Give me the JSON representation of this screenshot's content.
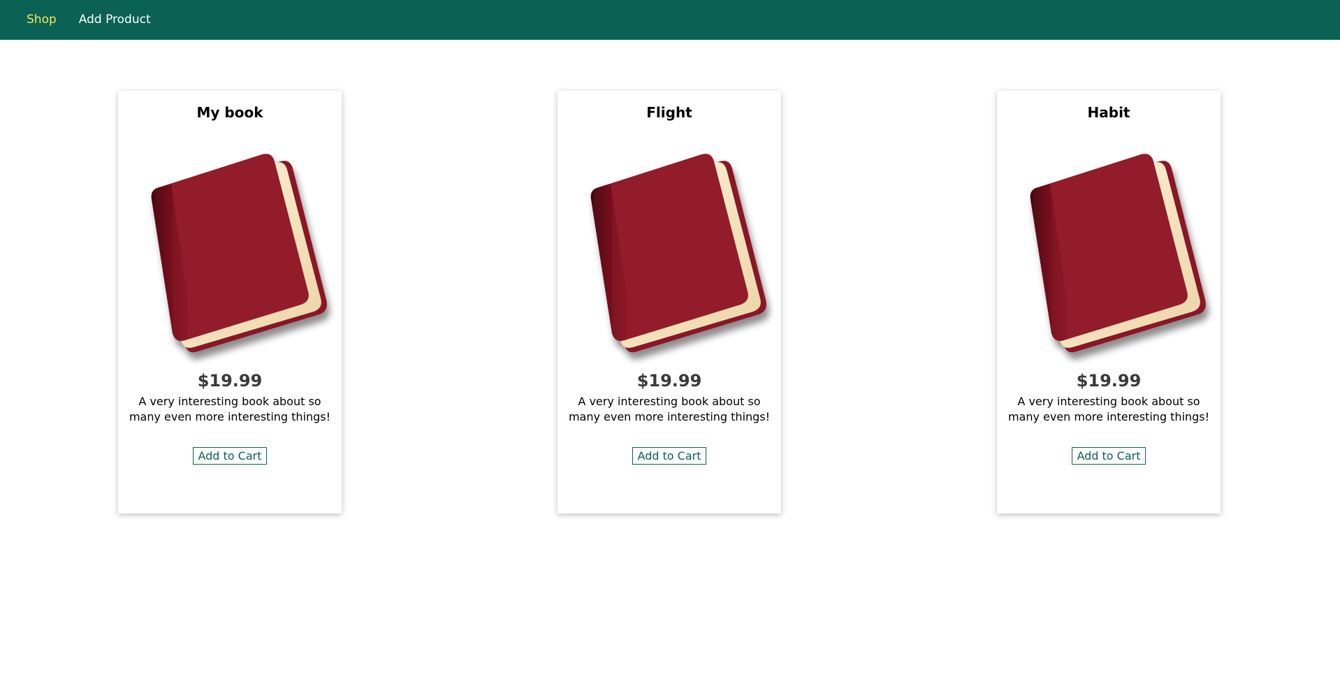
{
  "nav": {
    "items": [
      {
        "label": "Shop",
        "active": true
      },
      {
        "label": "Add Product",
        "active": false
      }
    ]
  },
  "theme": {
    "header_bg": "#0b6153",
    "active_link": "#f6e75a",
    "accent": "#0b6153",
    "book_cover": "#931c2b"
  },
  "products": [
    {
      "title": "My book",
      "image_icon": "red-book-icon",
      "price": "$19.99",
      "description": "A very interesting book about so many even more interesting things!",
      "button_label": "Add to Cart"
    },
    {
      "title": "Flight",
      "image_icon": "red-book-icon",
      "price": "$19.99",
      "description": "A very interesting book about so many even more interesting things!",
      "button_label": "Add to Cart"
    },
    {
      "title": "Habit",
      "image_icon": "red-book-icon",
      "price": "$19.99",
      "description": "A very interesting book about so many even more interesting things!",
      "button_label": "Add to Cart"
    }
  ]
}
